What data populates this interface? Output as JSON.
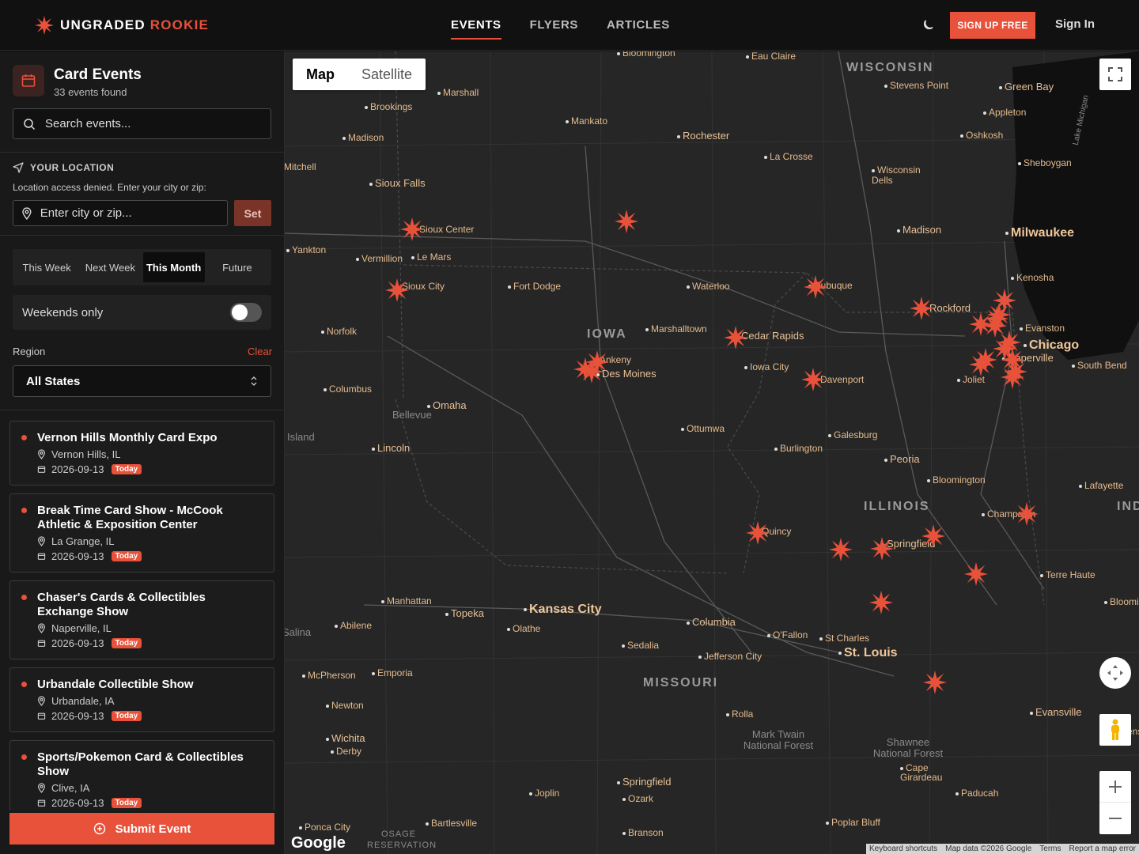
{
  "brand": {
    "name_a": "UNGRADED",
    "name_b": "ROOKIE"
  },
  "nav": [
    {
      "label": "EVENTS"
    },
    {
      "label": "FLYERS"
    },
    {
      "label": "ARTICLES"
    }
  ],
  "header": {
    "signup": "SIGN UP FREE",
    "signin": "Sign In"
  },
  "sidebar": {
    "title": "Card Events",
    "count": "33 events found",
    "search_placeholder": "Search events...",
    "location_label": "YOUR LOCATION",
    "location_msg": "Location access denied. Enter your city or zip:",
    "location_placeholder": "Enter city or zip...",
    "set_label": "Set",
    "tabs": [
      {
        "label": "This Week"
      },
      {
        "label": "Next Week"
      },
      {
        "label": "This Month"
      },
      {
        "label": "Future"
      }
    ],
    "active_tab": "This Month",
    "weekends_label": "Weekends only",
    "weekends_on": false,
    "region_label": "Region",
    "clear_label": "Clear",
    "region_value": "All States",
    "submit_label": "Submit Event"
  },
  "events": [
    {
      "title": "Vernon Hills Monthly Card Expo",
      "location": "Vernon Hills, IL",
      "date": "2026-09-13",
      "badge": "Today"
    },
    {
      "title": "Break Time Card Show - McCook Athletic & Exposition Center",
      "location": "La Grange, IL",
      "date": "2026-09-13",
      "badge": "Today"
    },
    {
      "title": "Chaser's Cards & Collectibles Exchange Show",
      "location": "Naperville, IL",
      "date": "2026-09-13",
      "badge": "Today"
    },
    {
      "title": "Urbandale Collectible Show",
      "location": "Urbandale, IA",
      "date": "2026-09-13",
      "badge": "Today"
    },
    {
      "title": "Sports/Pokemon Card & Collectibles Show",
      "location": "Clive, IA",
      "date": "2026-09-13",
      "badge": "Today"
    }
  ],
  "map": {
    "type_tabs": [
      {
        "label": "Map"
      },
      {
        "label": "Satellite"
      }
    ],
    "active_type": "Map",
    "google_label": "Google",
    "attribution": [
      {
        "label": "Keyboard shortcuts"
      },
      {
        "label": "Map data ©2026 Google"
      },
      {
        "label": "Terms"
      },
      {
        "label": "Report a map error"
      }
    ],
    "places": [
      {
        "name": "Bloomington"
      },
      {
        "name": "Eau Claire"
      },
      {
        "name": "WISCONSIN"
      },
      {
        "name": "Stevens Point"
      },
      {
        "name": "Green Bay"
      },
      {
        "name": "Marshall"
      },
      {
        "name": "Brookings"
      },
      {
        "name": "Appleton"
      },
      {
        "name": "Mankato"
      },
      {
        "name": "Oshkosh"
      },
      {
        "name": "Madison"
      },
      {
        "name": "Rochester"
      },
      {
        "name": "La Crosse"
      },
      {
        "name": "Sheboygan"
      },
      {
        "name": "Mitchell"
      },
      {
        "name": "Wisconsin Dells"
      },
      {
        "name": "Sioux Falls"
      },
      {
        "name": "Sioux Center"
      },
      {
        "name": "Madison"
      },
      {
        "name": "Milwaukee"
      },
      {
        "name": "Yankton"
      },
      {
        "name": "Vermillion"
      },
      {
        "name": "Le Mars"
      },
      {
        "name": "Kenosha"
      },
      {
        "name": "Sioux City"
      },
      {
        "name": "Fort Dodge"
      },
      {
        "name": "Waterloo"
      },
      {
        "name": "Dubuque"
      },
      {
        "name": "Rockford"
      },
      {
        "name": "Norfolk"
      },
      {
        "name": "IOWA"
      },
      {
        "name": "Marshalltown"
      },
      {
        "name": "Cedar Rapids"
      },
      {
        "name": "Evanston"
      },
      {
        "name": "Chicago"
      },
      {
        "name": "Ankeny"
      },
      {
        "name": "Des Moines"
      },
      {
        "name": "Iowa City"
      },
      {
        "name": "Naperville"
      },
      {
        "name": "South Bend"
      },
      {
        "name": "Columbus"
      },
      {
        "name": "Davenport"
      },
      {
        "name": "Joliet"
      },
      {
        "name": "Omaha"
      },
      {
        "name": "Bellevue"
      },
      {
        "name": "Ottumwa"
      },
      {
        "name": "Galesburg"
      },
      {
        "name": "Island"
      },
      {
        "name": "Lincoln"
      },
      {
        "name": "Burlington"
      },
      {
        "name": "Peoria"
      },
      {
        "name": "Bloomington"
      },
      {
        "name": "Lafayette"
      },
      {
        "name": "ILLINOIS"
      },
      {
        "name": "INDIA"
      },
      {
        "name": "Champaign"
      },
      {
        "name": "Quincy"
      },
      {
        "name": "Springfield"
      },
      {
        "name": "Terre Haute"
      },
      {
        "name": "Manhattan"
      },
      {
        "name": "Topeka"
      },
      {
        "name": "Kansas City"
      },
      {
        "name": "Abilene"
      },
      {
        "name": "Olathe"
      },
      {
        "name": "Columbia"
      },
      {
        "name": "Salina"
      },
      {
        "name": "O'Fallon"
      },
      {
        "name": "St Charles"
      },
      {
        "name": "Bloomington"
      },
      {
        "name": "Sedalia"
      },
      {
        "name": "St. Louis"
      },
      {
        "name": "Jefferson City"
      },
      {
        "name": "McPherson"
      },
      {
        "name": "Emporia"
      },
      {
        "name": "MISSOURI"
      },
      {
        "name": "Newton"
      },
      {
        "name": "Rolla"
      },
      {
        "name": "Evansville"
      },
      {
        "name": "Wichita"
      },
      {
        "name": "Mark Twain National Forest"
      },
      {
        "name": "Shawnee National Forest"
      },
      {
        "name": "Owensboro"
      },
      {
        "name": "Derby"
      },
      {
        "name": "Cape Girardeau"
      },
      {
        "name": "Springfield"
      },
      {
        "name": "Joplin"
      },
      {
        "name": "Paducah"
      },
      {
        "name": "Ozark"
      },
      {
        "name": "Ponca City"
      },
      {
        "name": "Bartlesville"
      },
      {
        "name": "Poplar Bluff"
      },
      {
        "name": "Branson"
      },
      {
        "name": "OSAGE RESERVATION"
      },
      {
        "name": "Lake Michigan"
      }
    ]
  },
  "colors": {
    "accent": "#e8513a",
    "background": "#121212",
    "panel": "#191919",
    "map_bg": "#262626",
    "water": "#101010",
    "label": "#e5bb8d"
  },
  "icons": {
    "logo": "starburst-icon",
    "theme": "moon-icon",
    "calendar": "calendar-icon",
    "search": "search-icon",
    "location": "navigation-arrow-icon",
    "pin": "map-pin-icon",
    "submit": "plus-circle-icon",
    "fullscreen": "fullscreen-icon",
    "streetview": "pegman-icon"
  }
}
